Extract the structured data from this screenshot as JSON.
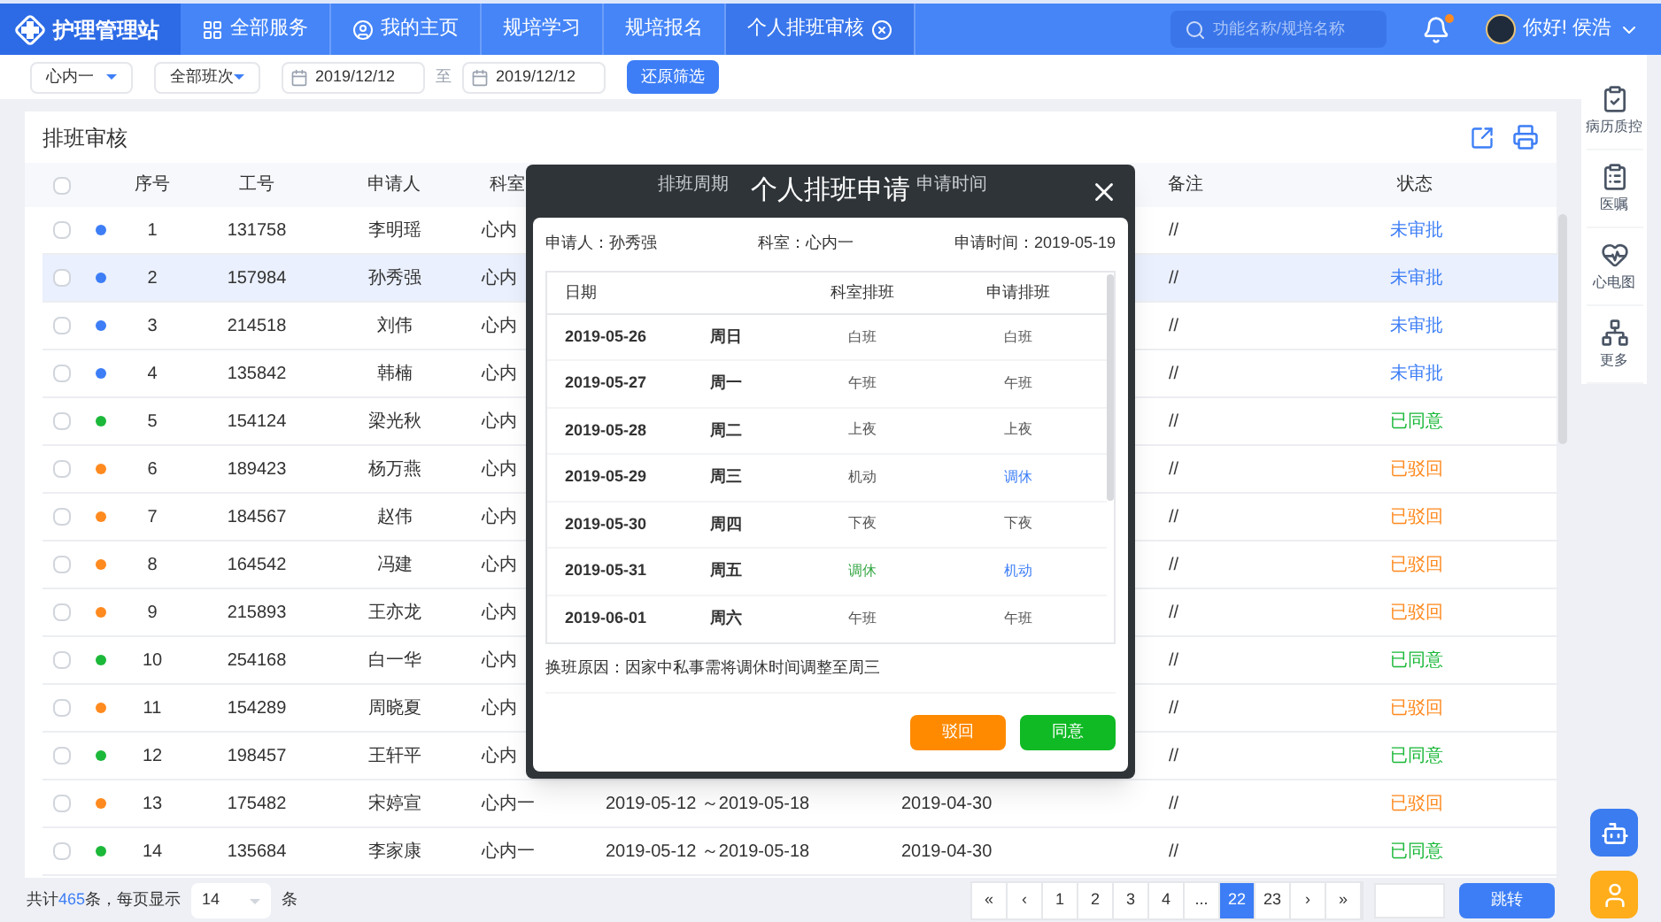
{
  "app": {
    "title": "护理管理站"
  },
  "nav_tabs": [
    {
      "label": "全部服务",
      "selected": false,
      "closable": false
    },
    {
      "label": "我的主页",
      "selected": false,
      "closable": false
    },
    {
      "label": "规培学习",
      "selected": false,
      "closable": false
    },
    {
      "label": "规培报名",
      "selected": false,
      "closable": false
    },
    {
      "label": "个人排班审核",
      "selected": true,
      "closable": true
    }
  ],
  "search": {
    "placeholder": "功能名称/规培名称"
  },
  "notifications": {
    "unread": true
  },
  "user": {
    "greeting": "你好! 侯浩"
  },
  "filters": {
    "department": "心内一",
    "shift": "全部班次",
    "date_from": "2019/12/12",
    "separator": "至",
    "date_to": "2019/12/12",
    "reset_button": "还原筛选"
  },
  "side_menu": [
    {
      "label": "病历质控"
    },
    {
      "label": "医嘱"
    },
    {
      "label": "心电图"
    },
    {
      "label": "更多"
    }
  ],
  "panel": {
    "title": "排班审核"
  },
  "table": {
    "all_checked": false,
    "columns": [
      "序号",
      "工号",
      "申请人",
      "科室",
      "排班周期",
      "申请时间",
      "备注",
      "状态"
    ],
    "rows": [
      {
        "no": "1",
        "id": "131758",
        "name": "李明瑶",
        "dept": "心内",
        "remark": "//",
        "status": "未审批",
        "color": "#3d7ef6",
        "selected": false,
        "checked": false
      },
      {
        "no": "2",
        "id": "157984",
        "name": "孙秀强",
        "dept": "心内",
        "remark": "//",
        "status": "未审批",
        "color": "#3d7ef6",
        "selected": true,
        "checked": false
      },
      {
        "no": "3",
        "id": "214518",
        "name": "刘伟",
        "dept": "心内",
        "remark": "//",
        "status": "未审批",
        "color": "#3d7ef6",
        "selected": false,
        "checked": false
      },
      {
        "no": "4",
        "id": "135842",
        "name": "韩楠",
        "dept": "心内",
        "remark": "//",
        "status": "未审批",
        "color": "#3d7ef6",
        "selected": false,
        "checked": false
      },
      {
        "no": "5",
        "id": "154124",
        "name": "梁光秋",
        "dept": "心内",
        "remark": "//",
        "status": "已同意",
        "color": "#1cb83a",
        "selected": false,
        "checked": false
      },
      {
        "no": "6",
        "id": "189423",
        "name": "杨万燕",
        "dept": "心内",
        "remark": "//",
        "status": "已驳回",
        "color": "#ff8a1f",
        "selected": false,
        "checked": false
      },
      {
        "no": "7",
        "id": "184567",
        "name": "赵伟",
        "dept": "心内",
        "remark": "//",
        "status": "已驳回",
        "color": "#ff8a1f",
        "selected": false,
        "checked": false
      },
      {
        "no": "8",
        "id": "164542",
        "name": "冯建",
        "dept": "心内",
        "remark": "//",
        "status": "已驳回",
        "color": "#ff8a1f",
        "selected": false,
        "checked": false
      },
      {
        "no": "9",
        "id": "215893",
        "name": "王亦龙",
        "dept": "心内",
        "remark": "//",
        "status": "已驳回",
        "color": "#ff8a1f",
        "selected": false,
        "checked": false
      },
      {
        "no": "10",
        "id": "254168",
        "name": "白一华",
        "dept": "心内",
        "remark": "//",
        "status": "已同意",
        "color": "#1cb83a",
        "selected": false,
        "checked": false
      },
      {
        "no": "11",
        "id": "154289",
        "name": "周晓夏",
        "dept": "心内",
        "remark": "//",
        "status": "已驳回",
        "color": "#ff8a1f",
        "selected": false,
        "checked": false
      },
      {
        "no": "12",
        "id": "198457",
        "name": "王轩平",
        "dept": "心内",
        "remark": "//",
        "status": "已同意",
        "color": "#1cb83a",
        "selected": false,
        "checked": false
      },
      {
        "no": "13",
        "id": "175482",
        "name": "宋婷宣",
        "dept": "心内一",
        "period": "2019-05-12 ～2019-05-18",
        "applied": "2019-04-30",
        "remark": "//",
        "status": "已驳回",
        "color": "#ff8a1f",
        "selected": false,
        "checked": false
      },
      {
        "no": "14",
        "id": "135684",
        "name": "李家康",
        "dept": "心内一",
        "period": "2019-05-12 ～2019-05-18",
        "applied": "2019-04-30",
        "remark": "//",
        "status": "已同意",
        "color": "#1cb83a",
        "selected": false,
        "checked": false
      }
    ]
  },
  "pagination": {
    "total_prefix": "共计",
    "total": "465",
    "total_suffix": "条，每页显示",
    "page_size": "14",
    "page_size_suffix": "条",
    "pages": [
      {
        "label": "«",
        "selected": false
      },
      {
        "label": "‹",
        "selected": false
      },
      {
        "label": "1",
        "selected": false
      },
      {
        "label": "2",
        "selected": false
      },
      {
        "label": "3",
        "selected": false
      },
      {
        "label": "4",
        "selected": false
      },
      {
        "label": "...",
        "selected": false
      },
      {
        "label": "22",
        "selected": true
      },
      {
        "label": "23",
        "selected": false
      },
      {
        "label": "›",
        "selected": false
      },
      {
        "label": "»",
        "selected": false
      }
    ],
    "jump_button": "跳转"
  },
  "dialog": {
    "title": "个人排班申请",
    "applicant_label": "申请人：",
    "applicant": "孙秀强",
    "dept_label": "科室：",
    "dept": "心内一",
    "time_label": "申请时间：",
    "time": "2019-05-19",
    "columns": [
      "日期",
      "科室排班",
      "申请排班"
    ],
    "rows": [
      {
        "date": "2019-05-26",
        "weekday": "周日",
        "dept_shift": "白班",
        "dept_rest": false,
        "requested_shift": "白班",
        "requested_changed": false
      },
      {
        "date": "2019-05-27",
        "weekday": "周一",
        "dept_shift": "午班",
        "dept_rest": false,
        "requested_shift": "午班",
        "requested_changed": false
      },
      {
        "date": "2019-05-28",
        "weekday": "周二",
        "dept_shift": "上夜",
        "dept_rest": false,
        "requested_shift": "上夜",
        "requested_changed": false
      },
      {
        "date": "2019-05-29",
        "weekday": "周三",
        "dept_shift": "机动",
        "dept_rest": false,
        "requested_shift": "调休",
        "requested_changed": true
      },
      {
        "date": "2019-05-30",
        "weekday": "周四",
        "dept_shift": "下夜",
        "dept_rest": false,
        "requested_shift": "下夜",
        "requested_changed": false
      },
      {
        "date": "2019-05-31",
        "weekday": "周五",
        "dept_shift": "调休",
        "dept_rest": true,
        "requested_shift": "机动",
        "requested_changed": true
      },
      {
        "date": "2019-06-01",
        "weekday": "周六",
        "dept_shift": "午班",
        "dept_rest": false,
        "requested_shift": "午班",
        "requested_changed": false
      }
    ],
    "reason_label": "换班原因：",
    "reason": "因家中私事需将调休时间调整至周三",
    "reject_button": "驳回",
    "approve_button": "同意"
  }
}
